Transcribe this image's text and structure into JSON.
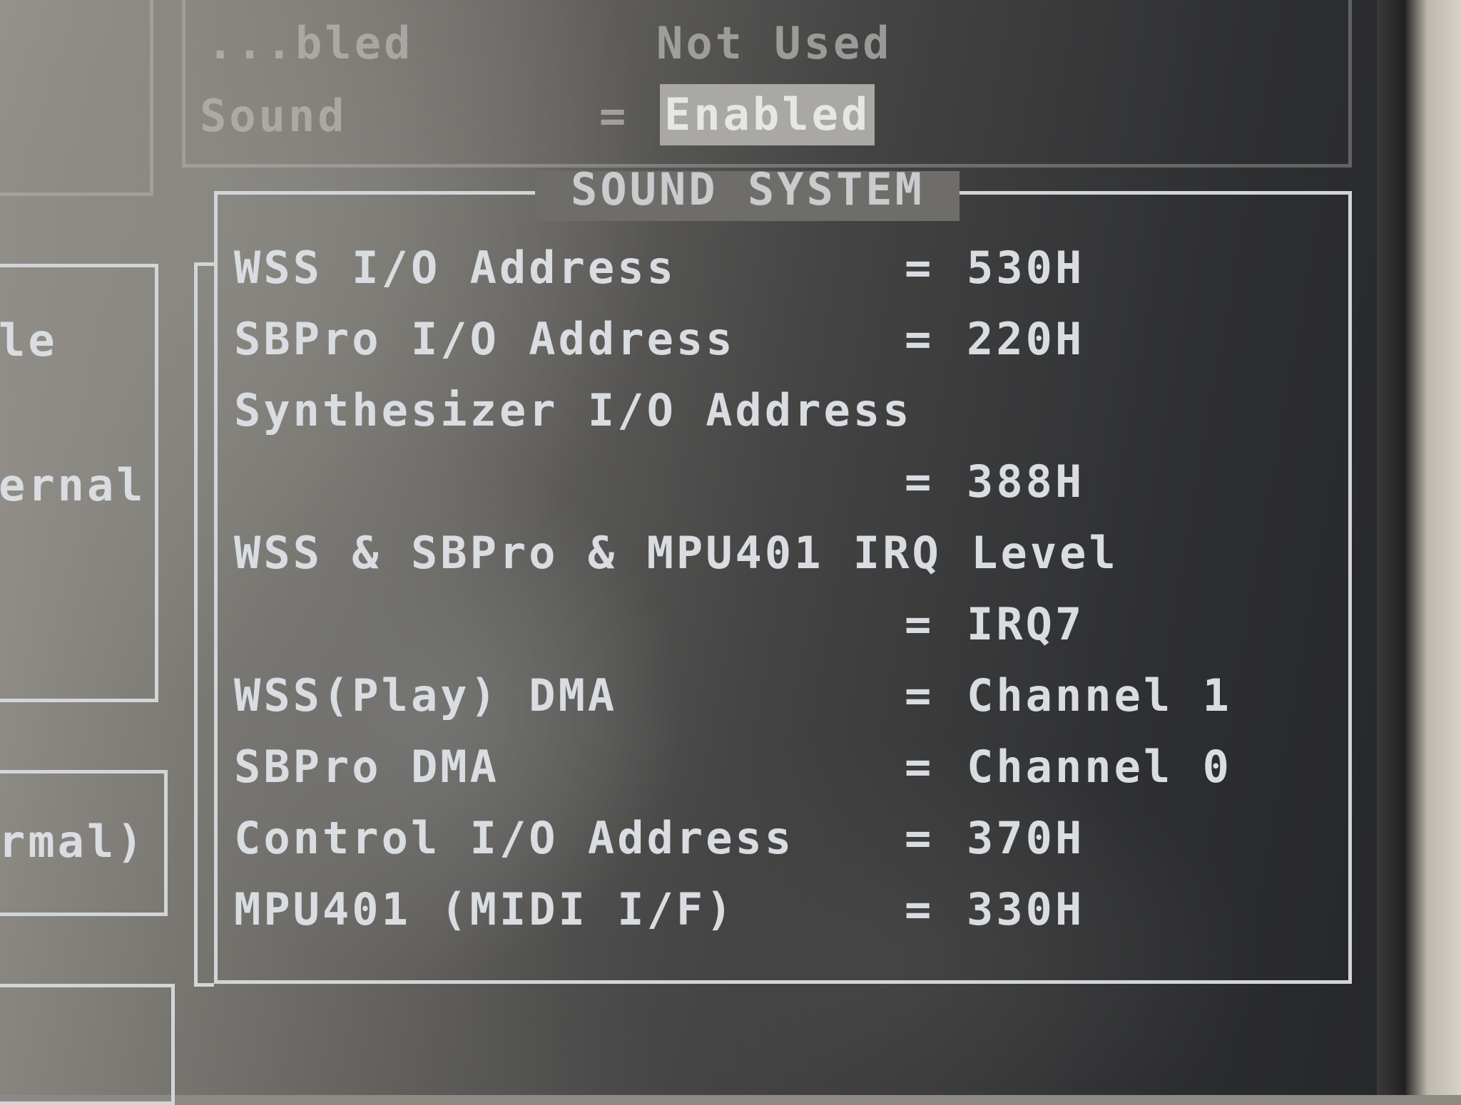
{
  "top": {
    "fragment_left": "...bled",
    "value_not_used": "Not Used",
    "sound_label": "Sound",
    "equals": "=",
    "sound_value": "Enabled"
  },
  "left_fragments": [
    "le",
    "ernal",
    "rmal)"
  ],
  "sound_system": {
    "title": "SOUND SYSTEM",
    "items": [
      {
        "label": "WSS I/O Address",
        "value": "530H"
      },
      {
        "label": "SBPro I/O Address",
        "value": "220H"
      },
      {
        "label": "Synthesizer I/O Address",
        "value": "388H"
      },
      {
        "label": "WSS & SBPro & MPU401 IRQ Level",
        "value": "IRQ7"
      },
      {
        "label": "WSS(Play) DMA",
        "value": "Channel 1"
      },
      {
        "label": "SBPro DMA",
        "value": "Channel 0"
      },
      {
        "label": "Control I/O Address",
        "value": "370H"
      },
      {
        "label": "MPU401 (MIDI I/F)",
        "value": "330H"
      }
    ],
    "equals": "="
  }
}
